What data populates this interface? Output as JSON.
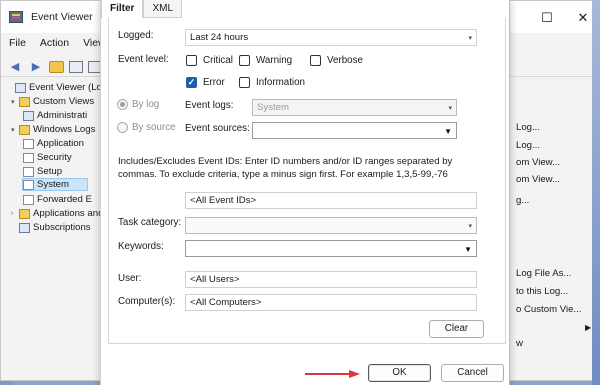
{
  "window": {
    "title": "Event Viewer",
    "minimize": "—",
    "maximize": "☐",
    "close": "✕",
    "menu": [
      "File",
      "Action",
      "View"
    ]
  },
  "tree": {
    "items": [
      {
        "label": "Event Viewer (Local)",
        "caret": "",
        "icon": "computer",
        "level": 0
      },
      {
        "label": "Custom Views",
        "caret": "▾",
        "icon": "folder",
        "level": 1
      },
      {
        "label": "Administrati",
        "caret": "",
        "icon": "filter",
        "level": 2
      },
      {
        "label": "Windows Logs",
        "caret": "▾",
        "icon": "folder",
        "level": 1
      },
      {
        "label": "Application",
        "caret": "",
        "icon": "log",
        "level": 2
      },
      {
        "label": "Security",
        "caret": "",
        "icon": "log",
        "level": 2
      },
      {
        "label": "Setup",
        "caret": "",
        "icon": "log",
        "level": 2
      },
      {
        "label": "System",
        "caret": "",
        "icon": "log",
        "level": 2,
        "selected": true
      },
      {
        "label": "Forwarded E",
        "caret": "",
        "icon": "log",
        "level": 2
      },
      {
        "label": "Applications and",
        "caret": "›",
        "icon": "folder",
        "level": 1
      },
      {
        "label": "Subscriptions",
        "caret": "",
        "icon": "subscription",
        "level": 1
      }
    ]
  },
  "actions_pane": {
    "items": [
      "Log...",
      "Log...",
      "om View...",
      "om View...",
      "g...",
      "Log File As...",
      "to this Log...",
      "o Custom Vie...",
      "w"
    ]
  },
  "dialog": {
    "tabs": {
      "filter": "Filter",
      "xml": "XML"
    },
    "logged": {
      "label": "Logged:",
      "value": "Last 24 hours"
    },
    "event_level": {
      "label": "Event level:",
      "critical": "Critical",
      "warning": "Warning",
      "verbose": "Verbose",
      "error": "Error",
      "information": "Information"
    },
    "by_log": {
      "label": "By log",
      "event_logs_label": "Event logs:",
      "event_logs_value": "System"
    },
    "by_source": {
      "label": "By source",
      "event_sources_label": "Event sources:",
      "event_sources_value": ""
    },
    "info_text": "Includes/Excludes Event IDs: Enter ID numbers and/or ID ranges separated by commas. To exclude criteria, type a minus sign first. For example 1,3,5-99,-76",
    "event_ids_value": "<All Event IDs>",
    "task_category": {
      "label": "Task category:",
      "value": ""
    },
    "keywords": {
      "label": "Keywords:",
      "value": ""
    },
    "user": {
      "label": "User:",
      "value": "<All Users>"
    },
    "computers": {
      "label": "Computer(s):",
      "value": "<All Computers>"
    },
    "clear_button": "Clear",
    "ok_button": "OK",
    "cancel_button": "Cancel"
  },
  "colors": {
    "accent": "#1a5fb4",
    "arrow": "#d63a3a",
    "selection": "#cce4f7"
  }
}
